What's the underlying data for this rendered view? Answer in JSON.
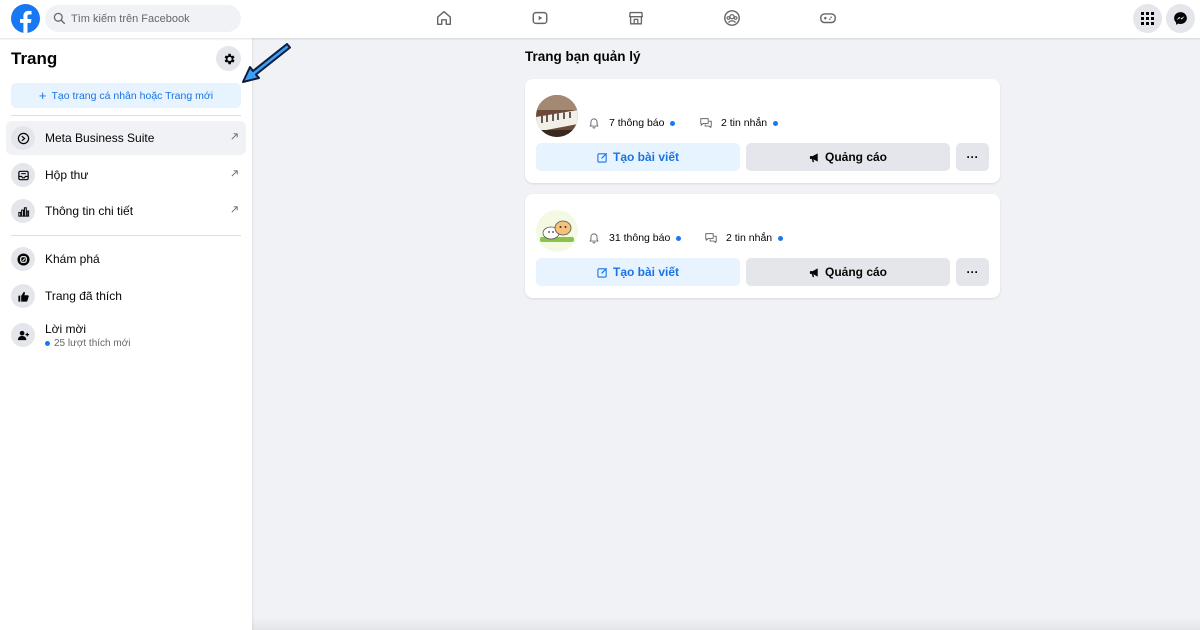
{
  "topbar": {
    "search_placeholder": "Tìm kiếm trên Facebook",
    "nav": [
      "home-icon",
      "watch-icon",
      "marketplace-icon",
      "groups-icon",
      "gaming-icon"
    ],
    "right": [
      "menu-grid-icon",
      "messenger-icon"
    ],
    "brand_color": "#1877f2"
  },
  "sidebar": {
    "title": "Trang",
    "create_label": "Tạo trang cá nhân hoặc Trang mới",
    "tools": [
      {
        "label": "Meta Business Suite",
        "icon": "meta-business-suite-icon"
      },
      {
        "label": "Hộp thư",
        "icon": "inbox-icon"
      },
      {
        "label": "Thông tin chi tiết",
        "icon": "insights-icon"
      }
    ],
    "links": [
      {
        "label": "Khám phá",
        "icon": "discover-icon"
      },
      {
        "label": "Trang đã thích",
        "icon": "like-icon"
      },
      {
        "label": "Lời mời",
        "sub": "25 lượt thích mới",
        "icon": "invite-icon"
      }
    ]
  },
  "main": {
    "title": "Trang bạn quản lý",
    "pages": [
      {
        "notifications": "7 thông báo",
        "messages": "2 tin nhắn",
        "create_post": "Tạo bài viết",
        "ads": "Quảng cáo",
        "more": "···",
        "avatar": "piano-avatar"
      },
      {
        "notifications": "31 thông báo",
        "messages": "2 tin nhắn",
        "create_post": "Tạo bài viết",
        "ads": "Quảng cáo",
        "more": "···",
        "avatar": "cartoon-avatar"
      }
    ]
  }
}
